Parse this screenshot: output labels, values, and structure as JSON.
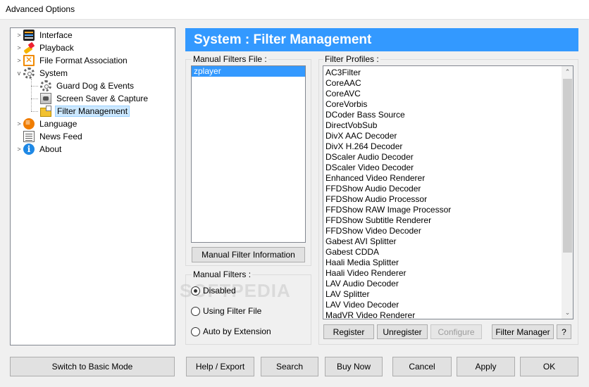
{
  "window": {
    "title": "Advanced Options"
  },
  "tree": {
    "items": [
      {
        "label": "Interface",
        "icon": "interface-icon"
      },
      {
        "label": "Playback",
        "icon": "playback-icon"
      },
      {
        "label": "File Format Association",
        "icon": "file-format-icon"
      },
      {
        "label": "System",
        "icon": "gear-icon"
      },
      {
        "label": "Guard Dog & Events",
        "icon": "gear-icon"
      },
      {
        "label": "Screen Saver & Capture",
        "icon": "screen-saver-icon"
      },
      {
        "label": "Filter Management",
        "icon": "filter-icon",
        "selected": true
      },
      {
        "label": "Language",
        "icon": "language-icon"
      },
      {
        "label": "News Feed",
        "icon": "news-icon"
      },
      {
        "label": "About",
        "icon": "info-icon",
        "glyph": "i"
      }
    ]
  },
  "header": {
    "title": "System : Filter Management"
  },
  "manual_filters_file": {
    "title": "Manual Filters File :",
    "items": [
      "zplayer"
    ],
    "info_button": "Manual Filter Information"
  },
  "manual_filters": {
    "title": "Manual Filters :",
    "options": [
      "Disabled",
      "Using Filter File",
      "Auto by Extension"
    ],
    "selected": "Disabled"
  },
  "filter_profiles": {
    "title": "Filter Profiles :",
    "items": [
      "AC3Filter",
      "CoreAAC",
      "CoreAVC",
      "CoreVorbis",
      "DCoder Bass Source",
      "DirectVobSub",
      "DivX AAC Decoder",
      "DivX H.264 Decoder",
      "DScaler Audio Decoder",
      "DScaler Video Decoder",
      "Enhanced Video Renderer",
      "FFDShow Audio Decoder",
      "FFDShow Audio Processor",
      "FFDShow RAW Image Processor",
      "FFDShow Subtitle Renderer",
      "FFDShow Video Decoder",
      "Gabest AVI Splitter",
      "Gabest CDDA",
      "Haali Media Splitter",
      "Haali Video Renderer",
      "LAV Audio Decoder",
      "LAV Splitter",
      "LAV Video Decoder",
      "MadVR Video Renderer"
    ],
    "buttons": {
      "register": "Register",
      "unregister": "Unregister",
      "configure": "Configure",
      "filter_manager": "Filter Manager",
      "help": "?"
    },
    "scroll_up": "⌃",
    "scroll_down": "⌄"
  },
  "bottom_bar": {
    "switch_basic": "Switch to Basic Mode",
    "help_export": "Help / Export",
    "search": "Search",
    "buy_now": "Buy Now",
    "cancel": "Cancel",
    "apply": "Apply",
    "ok": "OK"
  },
  "watermark": "SOFTPEDIA"
}
